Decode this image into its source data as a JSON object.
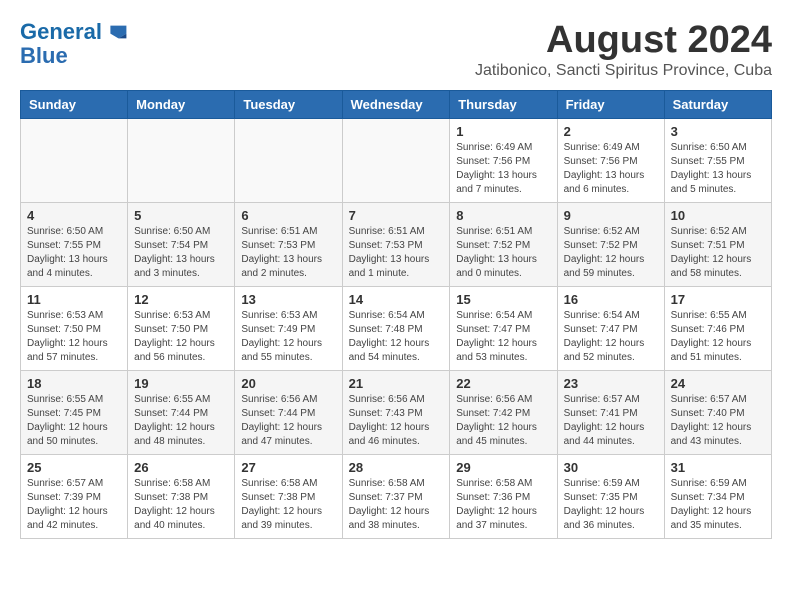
{
  "header": {
    "logo_line1": "General",
    "logo_line2": "Blue",
    "main_title": "August 2024",
    "subtitle": "Jatibonico, Sancti Spiritus Province, Cuba"
  },
  "days_of_week": [
    "Sunday",
    "Monday",
    "Tuesday",
    "Wednesday",
    "Thursday",
    "Friday",
    "Saturday"
  ],
  "weeks": [
    [
      {
        "day": "",
        "info": ""
      },
      {
        "day": "",
        "info": ""
      },
      {
        "day": "",
        "info": ""
      },
      {
        "day": "",
        "info": ""
      },
      {
        "day": "1",
        "info": "Sunrise: 6:49 AM\nSunset: 7:56 PM\nDaylight: 13 hours\nand 7 minutes."
      },
      {
        "day": "2",
        "info": "Sunrise: 6:49 AM\nSunset: 7:56 PM\nDaylight: 13 hours\nand 6 minutes."
      },
      {
        "day": "3",
        "info": "Sunrise: 6:50 AM\nSunset: 7:55 PM\nDaylight: 13 hours\nand 5 minutes."
      }
    ],
    [
      {
        "day": "4",
        "info": "Sunrise: 6:50 AM\nSunset: 7:55 PM\nDaylight: 13 hours\nand 4 minutes."
      },
      {
        "day": "5",
        "info": "Sunrise: 6:50 AM\nSunset: 7:54 PM\nDaylight: 13 hours\nand 3 minutes."
      },
      {
        "day": "6",
        "info": "Sunrise: 6:51 AM\nSunset: 7:53 PM\nDaylight: 13 hours\nand 2 minutes."
      },
      {
        "day": "7",
        "info": "Sunrise: 6:51 AM\nSunset: 7:53 PM\nDaylight: 13 hours\nand 1 minute."
      },
      {
        "day": "8",
        "info": "Sunrise: 6:51 AM\nSunset: 7:52 PM\nDaylight: 13 hours\nand 0 minutes."
      },
      {
        "day": "9",
        "info": "Sunrise: 6:52 AM\nSunset: 7:52 PM\nDaylight: 12 hours\nand 59 minutes."
      },
      {
        "day": "10",
        "info": "Sunrise: 6:52 AM\nSunset: 7:51 PM\nDaylight: 12 hours\nand 58 minutes."
      }
    ],
    [
      {
        "day": "11",
        "info": "Sunrise: 6:53 AM\nSunset: 7:50 PM\nDaylight: 12 hours\nand 57 minutes."
      },
      {
        "day": "12",
        "info": "Sunrise: 6:53 AM\nSunset: 7:50 PM\nDaylight: 12 hours\nand 56 minutes."
      },
      {
        "day": "13",
        "info": "Sunrise: 6:53 AM\nSunset: 7:49 PM\nDaylight: 12 hours\nand 55 minutes."
      },
      {
        "day": "14",
        "info": "Sunrise: 6:54 AM\nSunset: 7:48 PM\nDaylight: 12 hours\nand 54 minutes."
      },
      {
        "day": "15",
        "info": "Sunrise: 6:54 AM\nSunset: 7:47 PM\nDaylight: 12 hours\nand 53 minutes."
      },
      {
        "day": "16",
        "info": "Sunrise: 6:54 AM\nSunset: 7:47 PM\nDaylight: 12 hours\nand 52 minutes."
      },
      {
        "day": "17",
        "info": "Sunrise: 6:55 AM\nSunset: 7:46 PM\nDaylight: 12 hours\nand 51 minutes."
      }
    ],
    [
      {
        "day": "18",
        "info": "Sunrise: 6:55 AM\nSunset: 7:45 PM\nDaylight: 12 hours\nand 50 minutes."
      },
      {
        "day": "19",
        "info": "Sunrise: 6:55 AM\nSunset: 7:44 PM\nDaylight: 12 hours\nand 48 minutes."
      },
      {
        "day": "20",
        "info": "Sunrise: 6:56 AM\nSunset: 7:44 PM\nDaylight: 12 hours\nand 47 minutes."
      },
      {
        "day": "21",
        "info": "Sunrise: 6:56 AM\nSunset: 7:43 PM\nDaylight: 12 hours\nand 46 minutes."
      },
      {
        "day": "22",
        "info": "Sunrise: 6:56 AM\nSunset: 7:42 PM\nDaylight: 12 hours\nand 45 minutes."
      },
      {
        "day": "23",
        "info": "Sunrise: 6:57 AM\nSunset: 7:41 PM\nDaylight: 12 hours\nand 44 minutes."
      },
      {
        "day": "24",
        "info": "Sunrise: 6:57 AM\nSunset: 7:40 PM\nDaylight: 12 hours\nand 43 minutes."
      }
    ],
    [
      {
        "day": "25",
        "info": "Sunrise: 6:57 AM\nSunset: 7:39 PM\nDaylight: 12 hours\nand 42 minutes."
      },
      {
        "day": "26",
        "info": "Sunrise: 6:58 AM\nSunset: 7:38 PM\nDaylight: 12 hours\nand 40 minutes."
      },
      {
        "day": "27",
        "info": "Sunrise: 6:58 AM\nSunset: 7:38 PM\nDaylight: 12 hours\nand 39 minutes."
      },
      {
        "day": "28",
        "info": "Sunrise: 6:58 AM\nSunset: 7:37 PM\nDaylight: 12 hours\nand 38 minutes."
      },
      {
        "day": "29",
        "info": "Sunrise: 6:58 AM\nSunset: 7:36 PM\nDaylight: 12 hours\nand 37 minutes."
      },
      {
        "day": "30",
        "info": "Sunrise: 6:59 AM\nSunset: 7:35 PM\nDaylight: 12 hours\nand 36 minutes."
      },
      {
        "day": "31",
        "info": "Sunrise: 6:59 AM\nSunset: 7:34 PM\nDaylight: 12 hours\nand 35 minutes."
      }
    ]
  ]
}
